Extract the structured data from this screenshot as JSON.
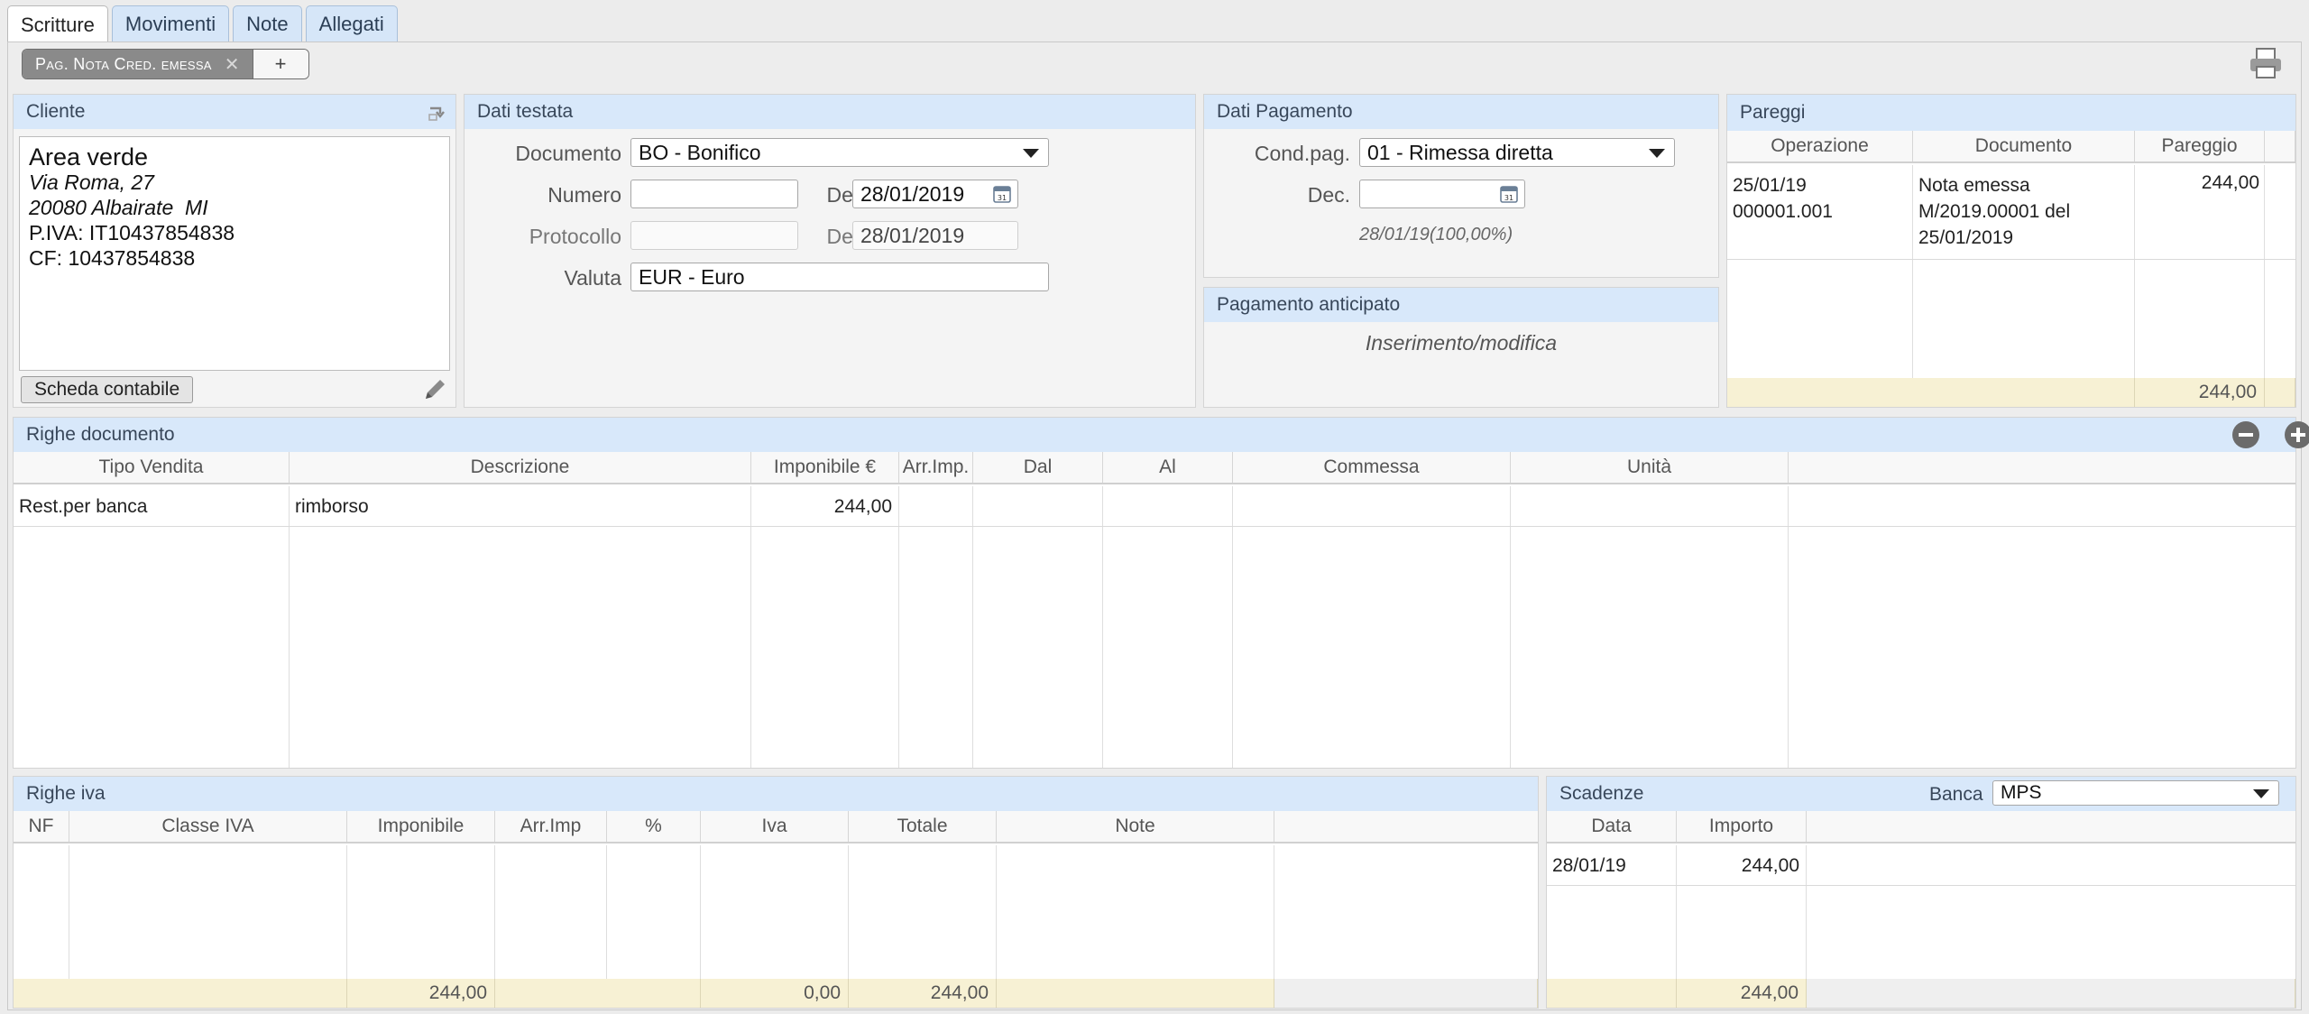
{
  "tabs": [
    "Scritture",
    "Movimenti",
    "Note",
    "Allegati"
  ],
  "toolbar": {
    "active_pill": "Pag. Nota Cred. emessa",
    "add_label": "+"
  },
  "cliente": {
    "title": "Cliente",
    "name": "Area verde",
    "street": "Via Roma, 27",
    "city": "20080 Albairate  MI",
    "piva": "P.IVA: IT10437854838",
    "cf": "CF: 10437854838",
    "scheda_button": "Scheda contabile"
  },
  "testata": {
    "title": "Dati testata",
    "documento_label": "Documento",
    "documento_value": "BO - Bonifico",
    "numero_label": "Numero",
    "numero_value": "",
    "del_label": "Del",
    "numero_date": "28/01/2019",
    "protocollo_label": "Protocollo",
    "protocollo_value": "",
    "protocollo_date": "28/01/2019",
    "valuta_label": "Valuta",
    "valuta_value": "EUR - Euro"
  },
  "pagamento": {
    "title": "Dati Pagamento",
    "cond_label": "Cond.pag.",
    "cond_value": "01 - Rimessa diretta",
    "dec_label": "Dec.",
    "dec_value": "",
    "schedule_note": "28/01/19(100,00%)"
  },
  "anticipato": {
    "title": "Pagamento anticipato",
    "note": "Inserimento/modifica"
  },
  "pareggi": {
    "title": "Pareggi",
    "columns": [
      "Operazione",
      "Documento",
      "Pareggio"
    ],
    "row": {
      "op1": "25/01/19",
      "op2": "000001.001",
      "doc1": "Nota emessa",
      "doc2": "M/2019.00001 del",
      "doc3": "25/01/2019",
      "pareggio": "244,00"
    },
    "total": "244,00"
  },
  "righe_documento": {
    "title": "Righe documento",
    "columns": [
      "Tipo Vendita",
      "Descrizione",
      "Imponibile €",
      "Arr.Imp.",
      "Dal",
      "Al",
      "Commessa",
      "Unità"
    ],
    "rows": [
      {
        "tipo": "Rest.per banca",
        "descrizione": "rimborso",
        "imponibile": "244,00"
      }
    ]
  },
  "righe_iva": {
    "title": "Righe iva",
    "columns": [
      "NF",
      "Classe IVA",
      "Imponibile",
      "Arr.Imp",
      "%",
      "Iva",
      "Totale",
      "Note"
    ],
    "totals": {
      "imponibile": "244,00",
      "iva": "0,00",
      "totale": "244,00"
    }
  },
  "scadenze": {
    "title": "Scadenze",
    "banca_label": "Banca",
    "banca_value": "MPS",
    "columns": [
      "Data",
      "Importo"
    ],
    "rows": [
      {
        "data": "28/01/19",
        "importo": "244,00"
      }
    ],
    "total": "244,00"
  }
}
